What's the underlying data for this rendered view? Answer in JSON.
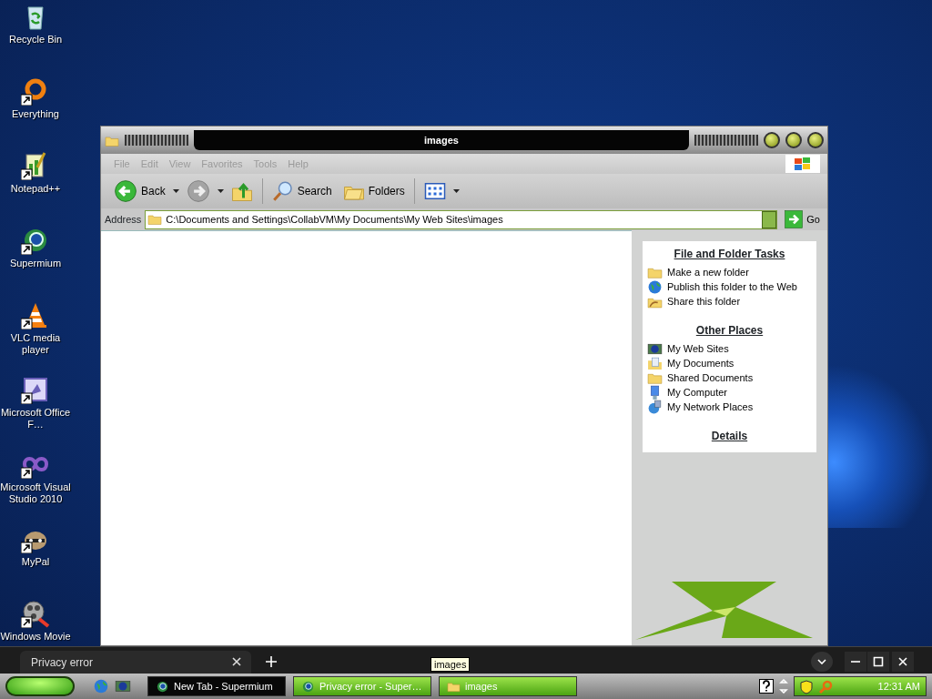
{
  "desktop_icons": [
    {
      "label": "Recycle Bin",
      "shortcut": false
    },
    {
      "label": "Everything",
      "shortcut": true
    },
    {
      "label": "Notepad++",
      "shortcut": true
    },
    {
      "label": "Supermium",
      "shortcut": true
    },
    {
      "label": "VLC media player",
      "shortcut": true
    },
    {
      "label": "Microsoft Office F…",
      "shortcut": true
    },
    {
      "label": "Microsoft Visual Studio 2010",
      "shortcut": true
    },
    {
      "label": "MyPal",
      "shortcut": true
    },
    {
      "label": "Windows Movie",
      "shortcut": true
    }
  ],
  "window": {
    "title": "images",
    "menu": [
      "File",
      "Edit",
      "View",
      "Favorites",
      "Tools",
      "Help"
    ],
    "toolbar": [
      {
        "kind": "back",
        "label": "Back",
        "disabled": false
      },
      {
        "kind": "forward",
        "disabled": true
      },
      {
        "kind": "up"
      },
      {
        "kind": "search",
        "label": "Search"
      },
      {
        "kind": "folders",
        "label": "Folders"
      },
      {
        "kind": "views"
      }
    ],
    "address": {
      "label": "Address",
      "value": "C:\\Documents and Settings\\CollabVM\\My Documents\\My Web Sites\\images",
      "go": "Go"
    },
    "task_groups": [
      {
        "title": "File and Folder Tasks",
        "items": [
          "Make a new folder",
          "Publish this folder to the Web",
          "Share this folder"
        ]
      },
      {
        "title": "Other Places",
        "items": [
          "My Web Sites",
          "My Documents",
          "Shared Documents",
          "My Computer",
          "My Network Places"
        ]
      },
      {
        "title": "Details"
      }
    ]
  },
  "browser_strip": {
    "tab": "Privacy error",
    "tooltip": "images"
  },
  "taskbar": {
    "buttons": [
      {
        "label": "New Tab - Supermium",
        "selected": false
      },
      {
        "label": "Privacy error - Super…",
        "selected": true
      },
      {
        "label": "images",
        "selected": true
      }
    ],
    "clock": "12:31 AM"
  }
}
